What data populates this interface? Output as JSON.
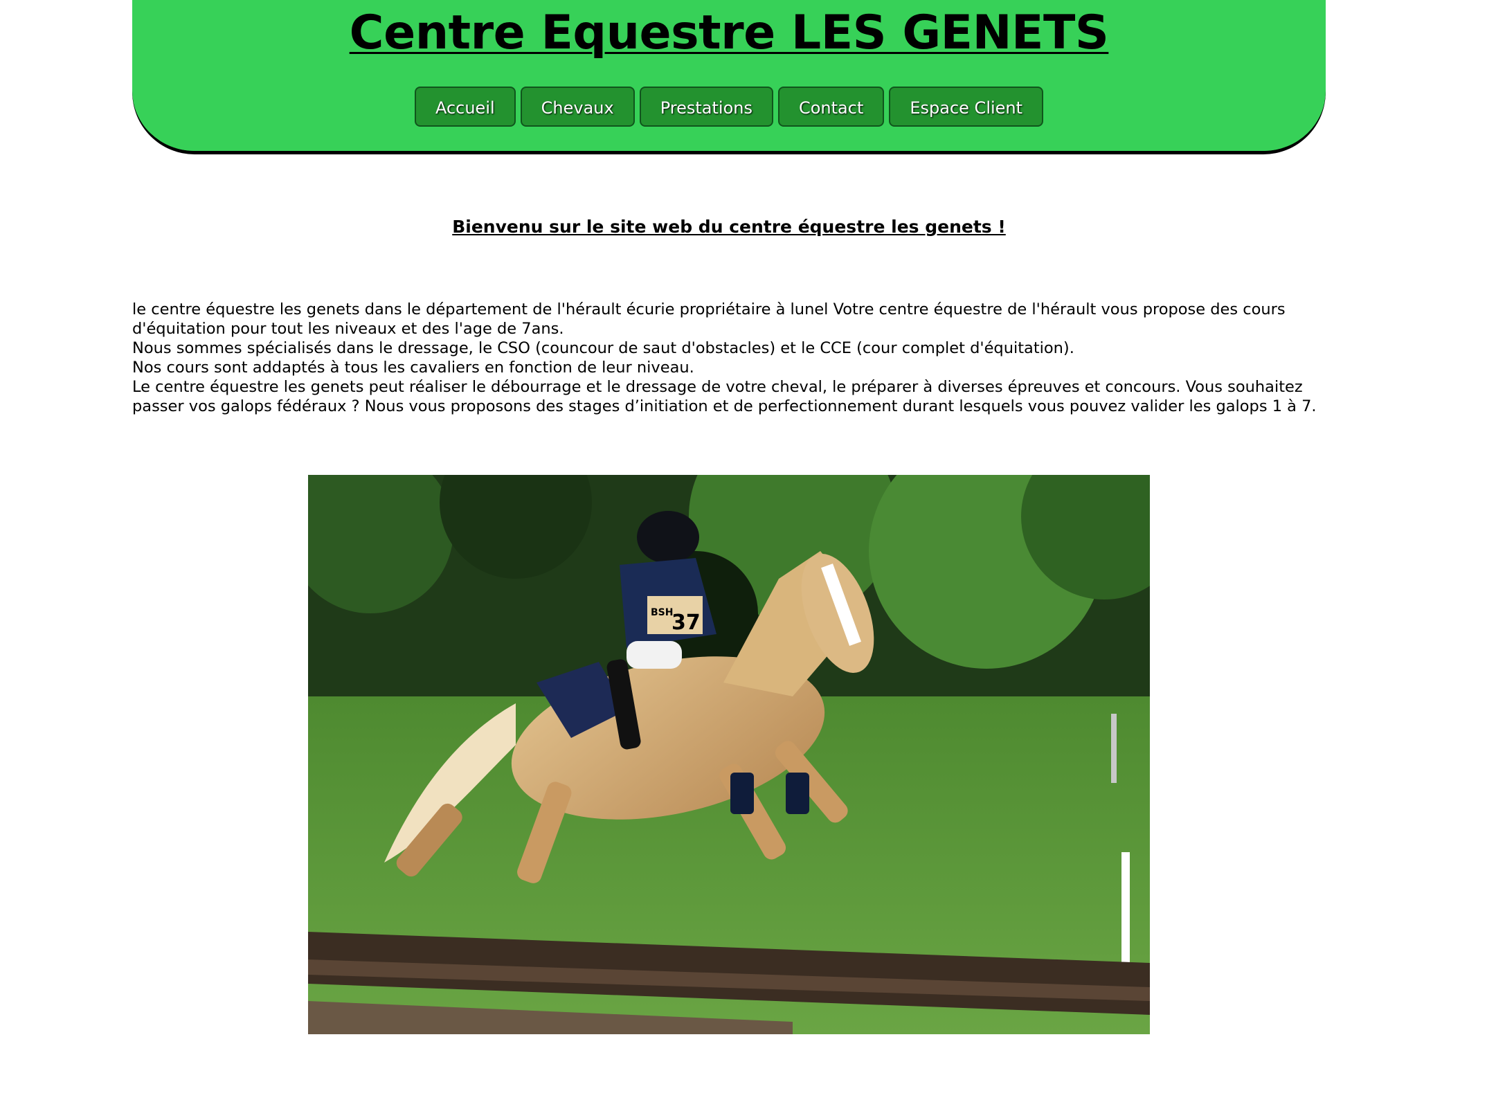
{
  "header": {
    "title": "Centre Equestre LES GENETS",
    "nav": [
      {
        "label": "Accueil"
      },
      {
        "label": "Chevaux"
      },
      {
        "label": "Prestations"
      },
      {
        "label": "Contact"
      },
      {
        "label": "Espace Client"
      }
    ],
    "background_color": "#37d158",
    "button_color": "#23922f"
  },
  "main": {
    "welcome": "Bienvenu sur le site web du centre équestre les genets !",
    "paragraphs": [
      "le centre équestre les genets dans le département de l'hérault écurie propriétaire à lunel Votre centre équestre de l'hérault vous propose des cours d'équitation pour tout les niveaux et des l'age de 7ans.",
      "Nous sommes spécialisés dans le dressage, le CSO (councour de saut d'obstacles) et le CCE (cour complet d'équitation).",
      "Nos cours sont addaptés à tous les cavaliers en fonction de leur niveau.",
      "Le centre équestre les genets peut réaliser le débourrage et le dressage de votre cheval, le préparer à diverses épreuves et concours. Vous souhaitez passer vos galops fédéraux ? Nous vous proposons des stages d’initiation et de perfectionnement durant lesquels vous pouvez valider les galops 1 à 7."
    ],
    "photo": {
      "bib_text": "BSH",
      "bib_number": "37"
    }
  }
}
